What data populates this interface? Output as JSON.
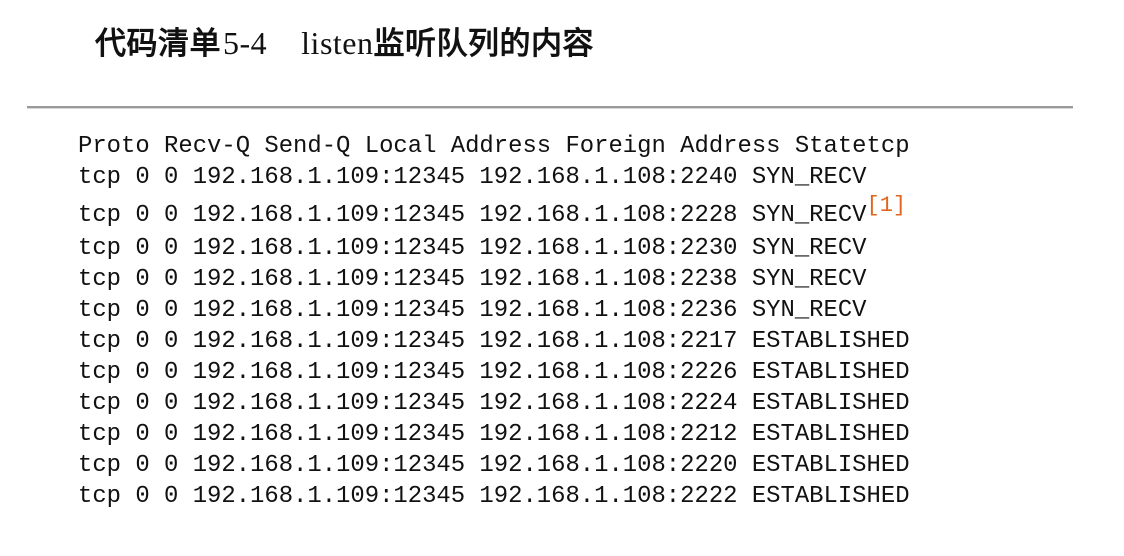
{
  "listing": {
    "label": "代码清单",
    "number": "5-4",
    "title_en": "listen",
    "title_zh": "监听队列的内容"
  },
  "code": {
    "header": "Proto Recv-Q Send-Q Local Address Foreign Address Statetcp",
    "lines": [
      {
        "text": "tcp 0 0 192.168.1.109:12345 192.168.1.108:2240 SYN_RECV"
      },
      {
        "text": "tcp 0 0 192.168.1.109:12345 192.168.1.108:2228 SYN_RECV",
        "note": "[1]"
      },
      {
        "text": "tcp 0 0 192.168.1.109:12345 192.168.1.108:2230 SYN_RECV"
      },
      {
        "text": "tcp 0 0 192.168.1.109:12345 192.168.1.108:2238 SYN_RECV"
      },
      {
        "text": "tcp 0 0 192.168.1.109:12345 192.168.1.108:2236 SYN_RECV"
      },
      {
        "text": "tcp 0 0 192.168.1.109:12345 192.168.1.108:2217 ESTABLISHED"
      },
      {
        "text": "tcp 0 0 192.168.1.109:12345 192.168.1.108:2226 ESTABLISHED"
      },
      {
        "text": "tcp 0 0 192.168.1.109:12345 192.168.1.108:2224 ESTABLISHED"
      },
      {
        "text": "tcp 0 0 192.168.1.109:12345 192.168.1.108:2212 ESTABLISHED"
      },
      {
        "text": "tcp 0 0 192.168.1.109:12345 192.168.1.108:2220 ESTABLISHED"
      },
      {
        "text": "tcp 0 0 192.168.1.109:12345 192.168.1.108:2222 ESTABLISHED"
      }
    ]
  },
  "colors": {
    "text": "#111111",
    "footnote": "#e0651e",
    "divider": "#9a9a9a"
  }
}
